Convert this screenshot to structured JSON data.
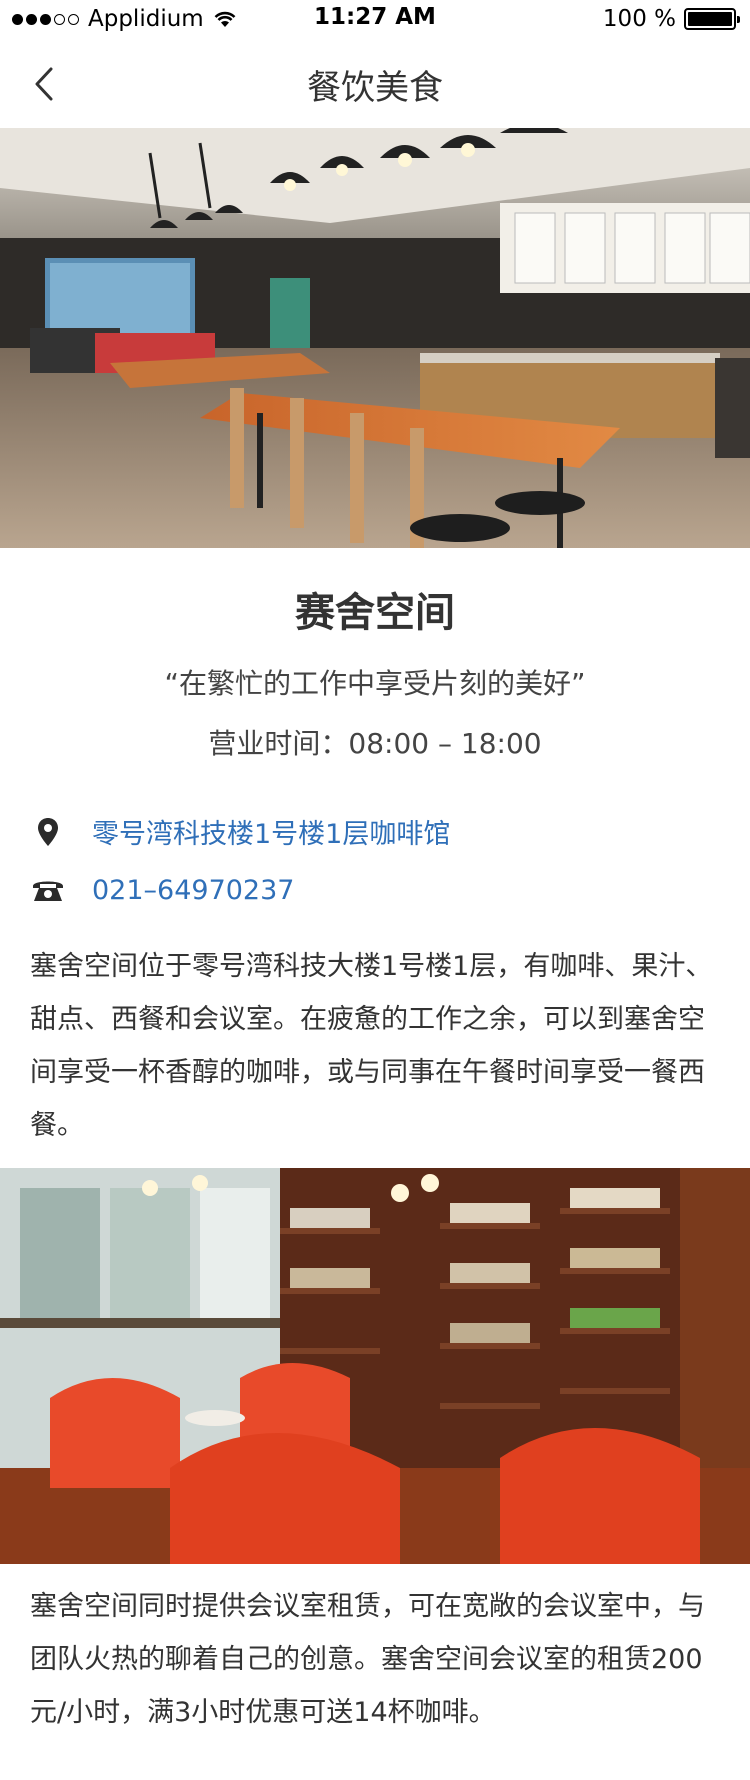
{
  "status_bar": {
    "carrier": "Applidium",
    "time": "11:27 AM",
    "battery": "100 %",
    "battery_level": 1.0
  },
  "nav": {
    "title": "餐饮美食",
    "back_icon": "chevron-left-icon"
  },
  "venue": {
    "name": "赛舍空间",
    "slogan": "“在繁忙的工作中享受片刻的美好”",
    "hours": "营业时间：08:00 – 18:00",
    "address": "零号湾科技楼1号楼1层咖啡馆",
    "phone": "021–64970237",
    "address_icon": "location-pin-icon",
    "phone_icon": "telephone-icon"
  },
  "content": {
    "paragraph1": "塞舍空间位于零号湾科技大楼1号楼1层，有咖啡、果汁、甜点、西餐和会议室。在疲惫的工作之余，可以到塞舍空间享受一杯香醇的咖啡，或与同事在午餐时间享受一餐西餐。",
    "paragraph2": "塞舍空间同时提供会议室租赁，可在宽敞的会议室中，与团队火热的聊着自己的创意。塞舍空间会议室的租赁200元/小时，满3小时优惠可送14杯咖啡。"
  },
  "colors": {
    "link": "#2f6fb8",
    "text": "#333333"
  }
}
